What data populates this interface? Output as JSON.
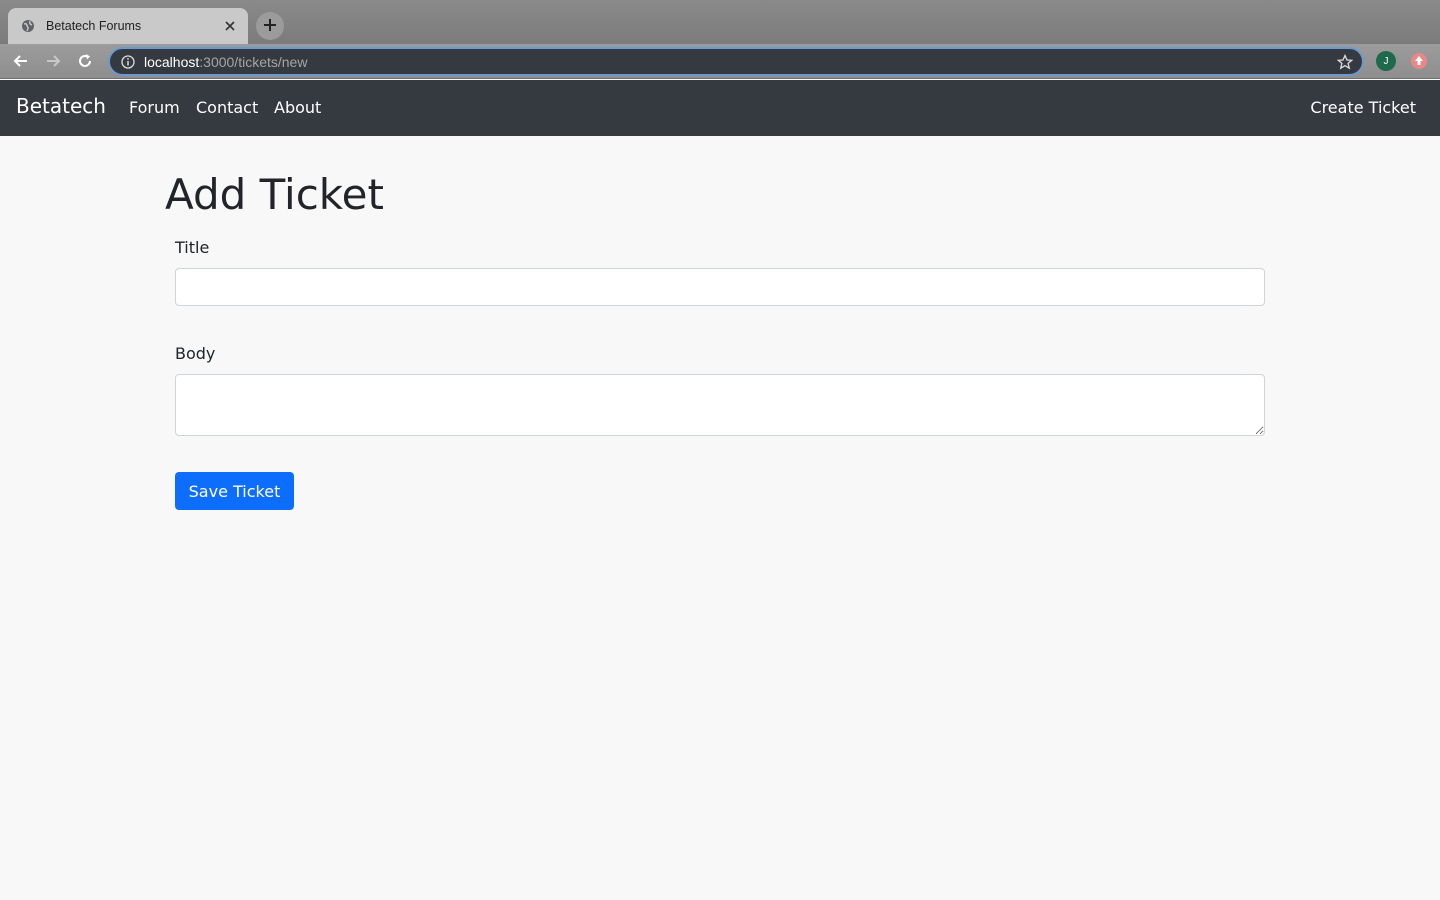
{
  "browser": {
    "tab_title": "Betatech Forums",
    "tab_favicon": "globe-icon",
    "url_host": "localhost",
    "url_path": ":3000/tickets/new",
    "profile_initial": "J",
    "accent": "#6a9ad0"
  },
  "navbar": {
    "brand": "Betatech",
    "links": [
      "Forum",
      "Contact",
      "About"
    ],
    "create_ticket": "Create Ticket",
    "background": "#343a40"
  },
  "form": {
    "heading": "Add Ticket",
    "title_label": "Title",
    "title_value": "",
    "body_label": "Body",
    "body_value": "",
    "save_label": "Save Ticket",
    "primary_color": "#0d6efd"
  }
}
